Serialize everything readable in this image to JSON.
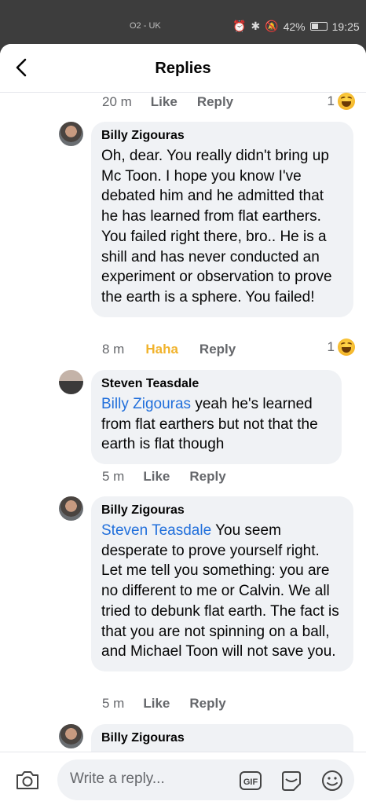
{
  "status": {
    "carrier": "O2 - UK",
    "battery": "42%",
    "time": "19:25"
  },
  "header": {
    "title": "Replies"
  },
  "prev_meta": {
    "time": "20 m",
    "like": "Like",
    "reply": "Reply",
    "reaction_count": "1"
  },
  "comments": [
    {
      "author": "Billy Zigouras",
      "mention": "",
      "text": "Oh, dear. You really didn't bring up Mc Toon. I hope you know I've debated him and he admitted that he has learned from flat earthers. You failed right there, bro.. He is a shill and has never conducted an experiment or observation to prove the earth is a sphere. You failed!",
      "time": "8 m",
      "like": "Haha",
      "reply": "Reply",
      "reaction_count": "1"
    },
    {
      "author": "Steven Teasdale",
      "mention": "Billy Zigouras",
      "text": " yeah he's learned from flat earthers but not that the earth is flat though",
      "time": "5 m",
      "like": "Like",
      "reply": "Reply"
    },
    {
      "author": "Billy Zigouras",
      "mention": "Steven Teasdale",
      "text": " You seem desperate to prove yourself right. Let me tell you something: you are no different to me or Calvin. We all tried to debunk flat earth. The fact is that you are not spinning on a ball, and Michael Toon will not save you.",
      "time": "5 m",
      "like": "Like",
      "reply": "Reply"
    },
    {
      "author": "Billy Zigouras"
    }
  ],
  "composer": {
    "placeholder": "Write a reply..."
  },
  "icons": {
    "back": "back-arrow-icon",
    "camera": "camera-icon",
    "gif": "gif-icon",
    "sticker": "sticker-icon",
    "emoji": "emoji-icon",
    "haha": "haha-reaction-icon"
  },
  "colors": {
    "mention": "#216fdb",
    "haha": "#f1b32c",
    "meta": "#65676b",
    "bubble": "#f0f2f5"
  }
}
